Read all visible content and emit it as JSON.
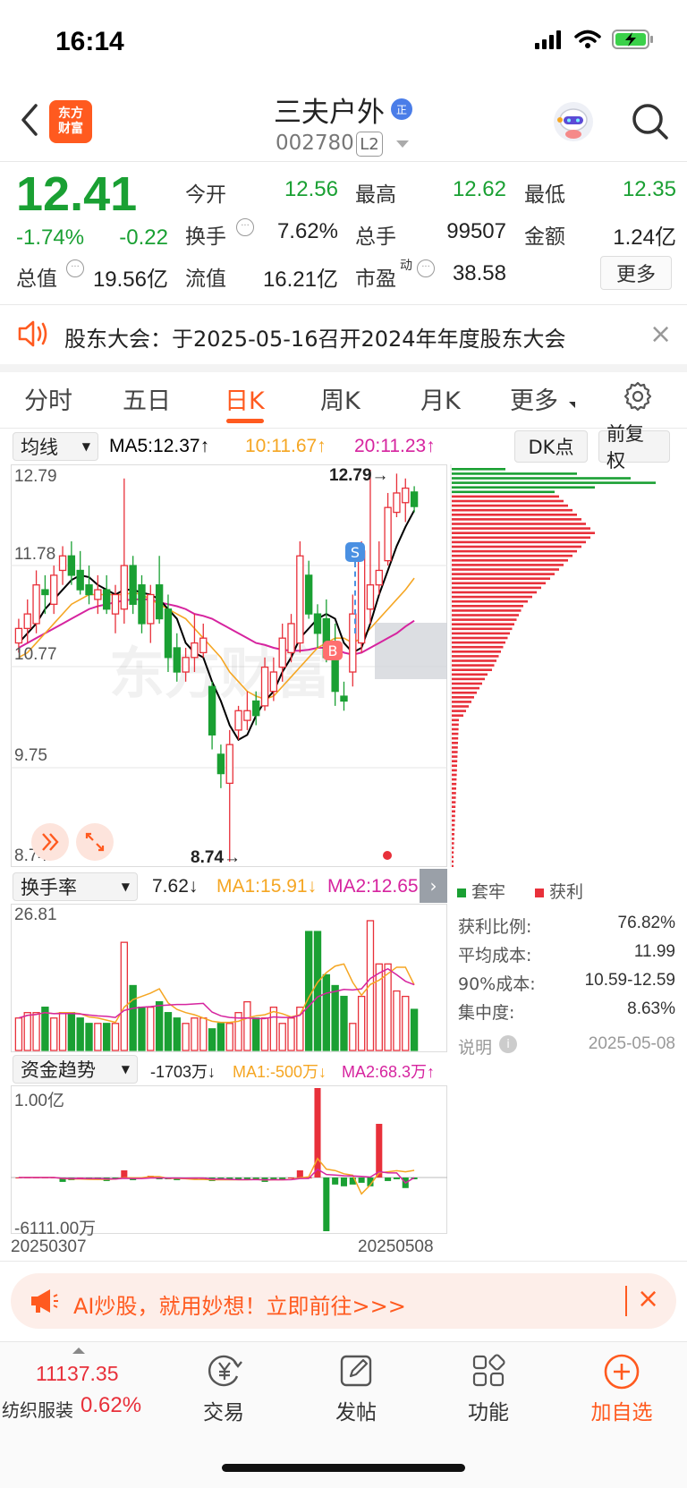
{
  "status_bar": {
    "time": "16:14"
  },
  "header": {
    "brand_logo_lines": [
      "东方",
      "财富"
    ],
    "title": "三夫户外",
    "title_badge": "正",
    "code": "002780",
    "level_badge": "L2"
  },
  "quote": {
    "price": "12.41",
    "change_pct": "-1.74%",
    "change": "-0.22",
    "rows": [
      [
        {
          "label": "今开",
          "value": "12.56",
          "color": "#1aa033"
        },
        {
          "label": "最高",
          "value": "12.62",
          "color": "#1aa033"
        },
        {
          "label": "最低",
          "value": "12.35",
          "color": "#1aa033"
        }
      ],
      [
        {
          "label": "换手",
          "value": "7.62%",
          "color": "#222222"
        },
        {
          "label": "总手",
          "value": "99507",
          "color": "#222222"
        },
        {
          "label": "金额",
          "value": "1.24亿",
          "color": "#222222"
        }
      ]
    ],
    "total_value_label": "总值",
    "total_value": "19.56亿",
    "float_label": "流值",
    "float_value": "16.21亿",
    "pe_label": "市盈",
    "pe_sup": "动",
    "pe_value": "38.58",
    "more_label": "更多"
  },
  "notice": {
    "text": "股东大会：于2025-05-16召开2024年年度股东大会",
    "close": "×"
  },
  "tabs": [
    {
      "label": "分时",
      "active": false
    },
    {
      "label": "五日",
      "active": false
    },
    {
      "label": "日K",
      "active": true
    },
    {
      "label": "周K",
      "active": false
    },
    {
      "label": "月K",
      "active": false
    },
    {
      "label": "更多",
      "active": false
    }
  ],
  "ma_line": {
    "selector": "均线",
    "ma5": "MA5:12.37↑",
    "ma10": "10:11.67↑",
    "ma20": "20:11.23↑",
    "dk_button": "DK点",
    "adjust_button": "前复权"
  },
  "kline": {
    "y_labels": [
      "12.79",
      "11.78",
      "10.77",
      "9.75",
      "8.74"
    ],
    "high_marker": "12.79→",
    "low_marker": "8.74→",
    "signal_s": "S",
    "signal_b": "B"
  },
  "turnover": {
    "selector": "换手率",
    "value": "7.62↓",
    "ma1": "MA1:15.91↓",
    "ma2": "MA2:12.65↓",
    "y_top": "26.81"
  },
  "fund": {
    "selector": "资金趋势",
    "value": "-1703万↓",
    "ma1": "MA1:-500万↓",
    "ma2": "MA2:68.3万↑",
    "y_top": "1.00亿",
    "y_bottom": "-6111.00万",
    "date_start": "20250307",
    "date_end": "20250508"
  },
  "chip": {
    "legend_trapped": "套牢",
    "legend_profit": "获利",
    "rows": [
      {
        "label": "获利比例:",
        "value": "76.82%"
      },
      {
        "label": "平均成本:",
        "value": "11.99"
      },
      {
        "label": "90%成本:",
        "value": "10.59-12.59"
      },
      {
        "label": "集中度:",
        "value": "8.63%"
      }
    ],
    "note_label": "说明",
    "date": "2025-05-08"
  },
  "ad": {
    "text": "AI炒股，就用妙想！立即前往>>>",
    "close": "×"
  },
  "bottom_nav": {
    "index_value": "11137.35",
    "index_name": "纺织服装",
    "index_change": "0.62%",
    "items": [
      "交易",
      "发帖",
      "功能",
      "加自选"
    ]
  },
  "colors": {
    "up": "#e8303a",
    "down": "#1aa033",
    "accent": "#ff5a1f",
    "ma5": "#000000",
    "ma10": "#f5a623",
    "ma20": "#d6249f"
  },
  "chart_data": {
    "type": "candlestick",
    "ylim": [
      8.74,
      12.79
    ],
    "candles": [
      {
        "o": 11.0,
        "h": 11.25,
        "l": 10.9,
        "c": 11.15
      },
      {
        "o": 11.15,
        "h": 11.45,
        "l": 11.0,
        "c": 11.3
      },
      {
        "o": 11.2,
        "h": 11.75,
        "l": 11.1,
        "c": 11.6
      },
      {
        "o": 11.55,
        "h": 11.7,
        "l": 11.3,
        "c": 11.5
      },
      {
        "o": 11.4,
        "h": 11.8,
        "l": 11.3,
        "c": 11.7
      },
      {
        "o": 11.75,
        "h": 12.0,
        "l": 11.6,
        "c": 11.9
      },
      {
        "o": 11.9,
        "h": 12.05,
        "l": 11.6,
        "c": 11.7
      },
      {
        "o": 11.75,
        "h": 11.95,
        "l": 11.5,
        "c": 11.55
      },
      {
        "o": 11.6,
        "h": 11.8,
        "l": 11.4,
        "c": 11.5
      },
      {
        "o": 11.45,
        "h": 11.7,
        "l": 11.3,
        "c": 11.55
      },
      {
        "o": 11.55,
        "h": 11.7,
        "l": 11.3,
        "c": 11.35
      },
      {
        "o": 11.3,
        "h": 11.6,
        "l": 11.1,
        "c": 11.5
      },
      {
        "o": 11.35,
        "h": 12.7,
        "l": 11.2,
        "c": 11.8
      },
      {
        "o": 11.8,
        "h": 11.9,
        "l": 11.3,
        "c": 11.4
      },
      {
        "o": 11.6,
        "h": 11.7,
        "l": 11.1,
        "c": 11.2
      },
      {
        "o": 11.2,
        "h": 11.6,
        "l": 11.0,
        "c": 11.5
      },
      {
        "o": 11.6,
        "h": 11.9,
        "l": 11.2,
        "c": 11.25
      },
      {
        "o": 11.35,
        "h": 11.5,
        "l": 10.7,
        "c": 10.85
      },
      {
        "o": 10.95,
        "h": 11.1,
        "l": 10.6,
        "c": 10.7
      },
      {
        "o": 10.7,
        "h": 10.95,
        "l": 10.6,
        "c": 10.85
      },
      {
        "o": 10.85,
        "h": 11.3,
        "l": 10.7,
        "c": 11.0
      },
      {
        "o": 10.9,
        "h": 11.2,
        "l": 10.85,
        "c": 11.05
      },
      {
        "o": 10.55,
        "h": 10.6,
        "l": 9.9,
        "c": 10.05
      },
      {
        "o": 9.85,
        "h": 9.95,
        "l": 9.5,
        "c": 9.65
      },
      {
        "o": 9.55,
        "h": 10.1,
        "l": 8.74,
        "c": 9.95
      },
      {
        "o": 10.1,
        "h": 10.35,
        "l": 10.0,
        "c": 10.3
      },
      {
        "o": 10.2,
        "h": 10.5,
        "l": 10.1,
        "c": 10.3
      },
      {
        "o": 10.4,
        "h": 10.5,
        "l": 10.15,
        "c": 10.25
      },
      {
        "o": 10.35,
        "h": 10.85,
        "l": 10.3,
        "c": 10.75
      },
      {
        "o": 10.5,
        "h": 10.85,
        "l": 10.4,
        "c": 10.7
      },
      {
        "o": 10.75,
        "h": 11.2,
        "l": 10.6,
        "c": 11.05
      },
      {
        "o": 10.9,
        "h": 11.3,
        "l": 10.8,
        "c": 11.2
      },
      {
        "o": 11.0,
        "h": 12.05,
        "l": 10.9,
        "c": 11.9
      },
      {
        "o": 11.7,
        "h": 11.85,
        "l": 11.25,
        "c": 11.3
      },
      {
        "o": 11.3,
        "h": 11.4,
        "l": 10.95,
        "c": 11.1
      },
      {
        "o": 11.25,
        "h": 11.45,
        "l": 10.8,
        "c": 10.85
      },
      {
        "o": 10.9,
        "h": 11.2,
        "l": 10.35,
        "c": 10.5
      },
      {
        "o": 10.45,
        "h": 10.6,
        "l": 10.3,
        "c": 10.4
      },
      {
        "o": 10.7,
        "h": 11.5,
        "l": 10.55,
        "c": 11.3
      },
      {
        "o": 11.0,
        "h": 12.05,
        "l": 10.9,
        "c": 11.95
      },
      {
        "o": 11.35,
        "h": 12.79,
        "l": 11.2,
        "c": 11.6
      },
      {
        "o": 11.6,
        "h": 12.05,
        "l": 11.5,
        "c": 11.75
      },
      {
        "o": 11.85,
        "h": 12.55,
        "l": 11.8,
        "c": 12.4
      },
      {
        "o": 12.35,
        "h": 12.75,
        "l": 12.3,
        "c": 12.55
      },
      {
        "o": 12.45,
        "h": 12.7,
        "l": 12.25,
        "c": 12.6
      },
      {
        "o": 12.56,
        "h": 12.62,
        "l": 12.35,
        "c": 12.41
      }
    ],
    "ma5": [
      11.0,
      11.1,
      11.2,
      11.35,
      11.45,
      11.55,
      11.65,
      11.7,
      11.68,
      11.6,
      11.55,
      11.5,
      11.55,
      11.55,
      11.52,
      11.5,
      11.45,
      11.35,
      11.25,
      11.0,
      10.9,
      10.85,
      10.6,
      10.4,
      10.15,
      10.0,
      10.05,
      10.25,
      10.4,
      10.5,
      10.7,
      10.85,
      11.05,
      11.15,
      11.25,
      11.3,
      11.25,
      11.0,
      10.9,
      10.95,
      11.2,
      11.5,
      11.75,
      12.0,
      12.2,
      12.37
    ],
    "ma10": [
      10.85,
      10.9,
      11.0,
      11.1,
      11.2,
      11.3,
      11.4,
      11.45,
      11.5,
      11.5,
      11.5,
      11.5,
      11.5,
      11.52,
      11.5,
      11.45,
      11.4,
      11.35,
      11.3,
      11.25,
      11.15,
      11.05,
      10.95,
      10.85,
      10.7,
      10.6,
      10.5,
      10.45,
      10.42,
      10.45,
      10.55,
      10.65,
      10.75,
      10.85,
      10.95,
      11.0,
      11.05,
      11.05,
      11.0,
      11.05,
      11.15,
      11.25,
      11.35,
      11.45,
      11.55,
      11.67
    ],
    "ma20": [
      10.95,
      11.0,
      11.05,
      11.1,
      11.15,
      11.2,
      11.25,
      11.3,
      11.35,
      11.38,
      11.4,
      11.42,
      11.44,
      11.45,
      11.45,
      11.45,
      11.42,
      11.4,
      11.38,
      11.35,
      11.3,
      11.28,
      11.25,
      11.2,
      11.15,
      11.1,
      11.05,
      11.0,
      10.98,
      10.95,
      10.93,
      10.92,
      10.92,
      10.93,
      10.95,
      10.95,
      10.95,
      10.9,
      10.88,
      10.9,
      10.95,
      11.0,
      11.05,
      11.1,
      11.17,
      11.23
    ]
  }
}
